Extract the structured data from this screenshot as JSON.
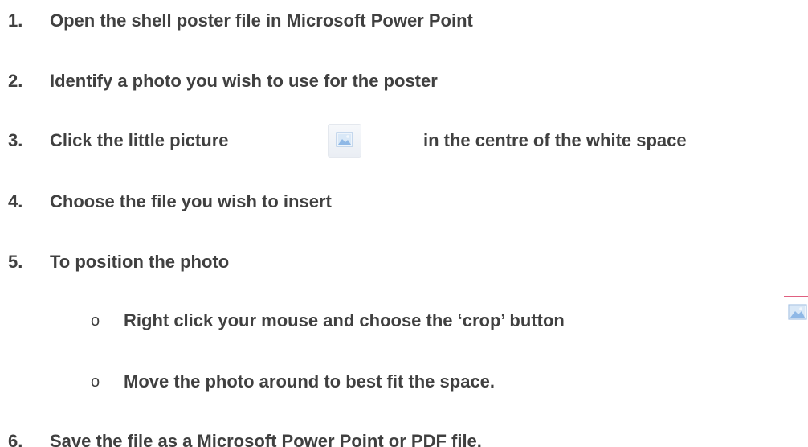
{
  "steps": [
    {
      "number": "1.",
      "text": "Open the shell poster file in Microsoft Power Point"
    },
    {
      "number": "2.",
      "text": "Identify a photo you wish to use for the poster"
    },
    {
      "number": "3.",
      "text_before": "Click the little picture",
      "text_after": "in the centre of the white space"
    },
    {
      "number": "4.",
      "text": "Choose the file you wish to insert"
    },
    {
      "number": "5.",
      "text": "To position the photo"
    },
    {
      "number": "6.",
      "text": "Save the file as a Microsoft Power Point or PDF file."
    }
  ],
  "substeps": [
    {
      "bullet": "o",
      "text": "Right click your mouse and choose the ‘crop’ button"
    },
    {
      "bullet": "o",
      "text": "Move the photo around to best fit the space."
    }
  ],
  "icons": {
    "picture": "picture-placeholder-icon",
    "crop": "crop-icon"
  },
  "colors": {
    "text": "#404040",
    "icon_frame": "#a9c4e4",
    "icon_sky": "#cfe2f6",
    "icon_mountain": "#8fb8e6"
  }
}
